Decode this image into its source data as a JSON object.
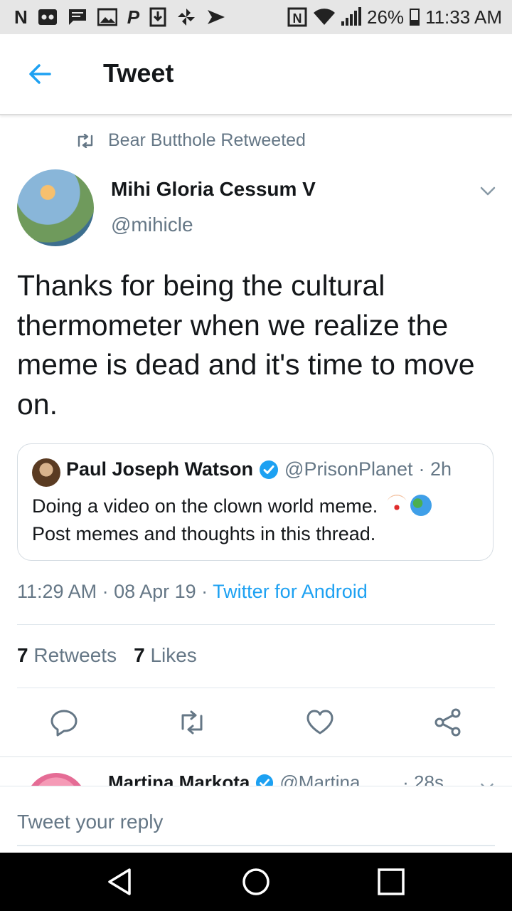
{
  "status_bar": {
    "left_icons": [
      "n-icon",
      "voicemail-icon",
      "message-icon",
      "image-icon",
      "paypal-icon",
      "download-icon",
      "fan-icon",
      "play-icon"
    ],
    "battery": "26%",
    "time": "11:33 AM"
  },
  "header": {
    "title": "Tweet"
  },
  "retweet_context": {
    "text": "Bear Butthole Retweeted"
  },
  "tweet": {
    "author_name": "Mihi Gloria Cessum V",
    "author_handle": "@mihicle",
    "text": "Thanks for being the cultural thermometer when we realize the meme is dead and it's time to move on.",
    "quoted": {
      "name": "Paul Joseph Watson",
      "handle": "@PrisonPlanet",
      "time": "· 2h",
      "text": "Doing a video on the clown world meme.",
      "text2": "Post memes and thoughts in this thread."
    },
    "time": "11:29 AM · 08 Apr 19 ·",
    "source": "Twitter for Android",
    "retweets_count": "7",
    "retweets_label": "Retweets",
    "likes_count": "7",
    "likes_label": "Likes"
  },
  "next_reply": {
    "name": "Martina Markota",
    "handle": "@Martina...",
    "time": "· 28s"
  },
  "reply_box": {
    "placeholder": "Tweet your reply"
  },
  "colors": {
    "accent": "#1da1f2",
    "secondary_text": "#657786"
  }
}
